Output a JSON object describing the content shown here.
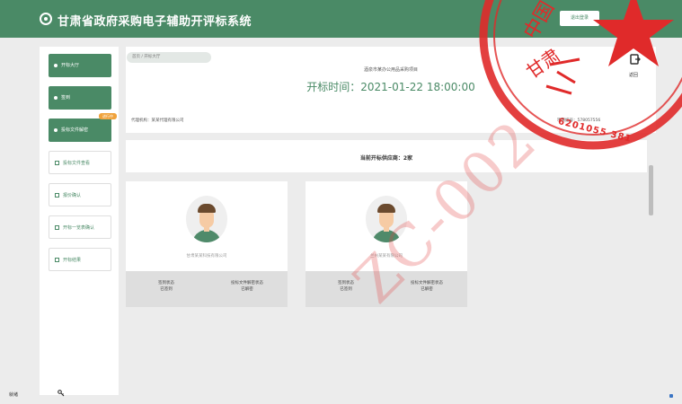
{
  "header": {
    "title": "甘肃省政府采购电子辅助开评标系统",
    "right_button_label": "退出登录"
  },
  "sidebar": {
    "items": [
      {
        "label": "开标大厅",
        "style": "green"
      },
      {
        "label": "签到",
        "style": "green"
      },
      {
        "label": "投标文件解密",
        "style": "green",
        "badge": "进行中"
      },
      {
        "label": "投标文件查看",
        "style": "white"
      },
      {
        "label": "报价确认",
        "style": "white"
      },
      {
        "label": "开标一览表确认",
        "style": "white"
      },
      {
        "label": "开标结果",
        "style": "white"
      }
    ]
  },
  "main": {
    "breadcrumb": "首页 / 开标大厅",
    "project_name": "酒泉市某办公用品采购项目",
    "open_time": "开标时间：2021-01-22 18:00:00",
    "agency": "代理机构：某某代理有限公司",
    "project_no": "项目编号：578057556",
    "side_button_label": "返回",
    "bidder_count": "当前开标供应商：2家"
  },
  "cards": [
    {
      "name": "甘肃某某科技有限公司",
      "left_label": "签到状态",
      "left_value": "已签到",
      "right_label": "投标文件解密状态",
      "right_value": "已解密"
    },
    {
      "name": "兰州某某有限公司",
      "left_label": "签到状态",
      "left_value": "已签到",
      "right_label": "投标文件解密状态",
      "right_value": "已解密"
    }
  ],
  "status_bar": {
    "left_text": "就绪"
  },
  "overlays": {
    "stamp_text": "中国 甘肃",
    "stamp_number": "6201055 381",
    "watermark": "ZC-002"
  },
  "colors": {
    "brand": "#4a8a66",
    "badge": "#f0a23b",
    "stamp": "#e02a2a"
  }
}
